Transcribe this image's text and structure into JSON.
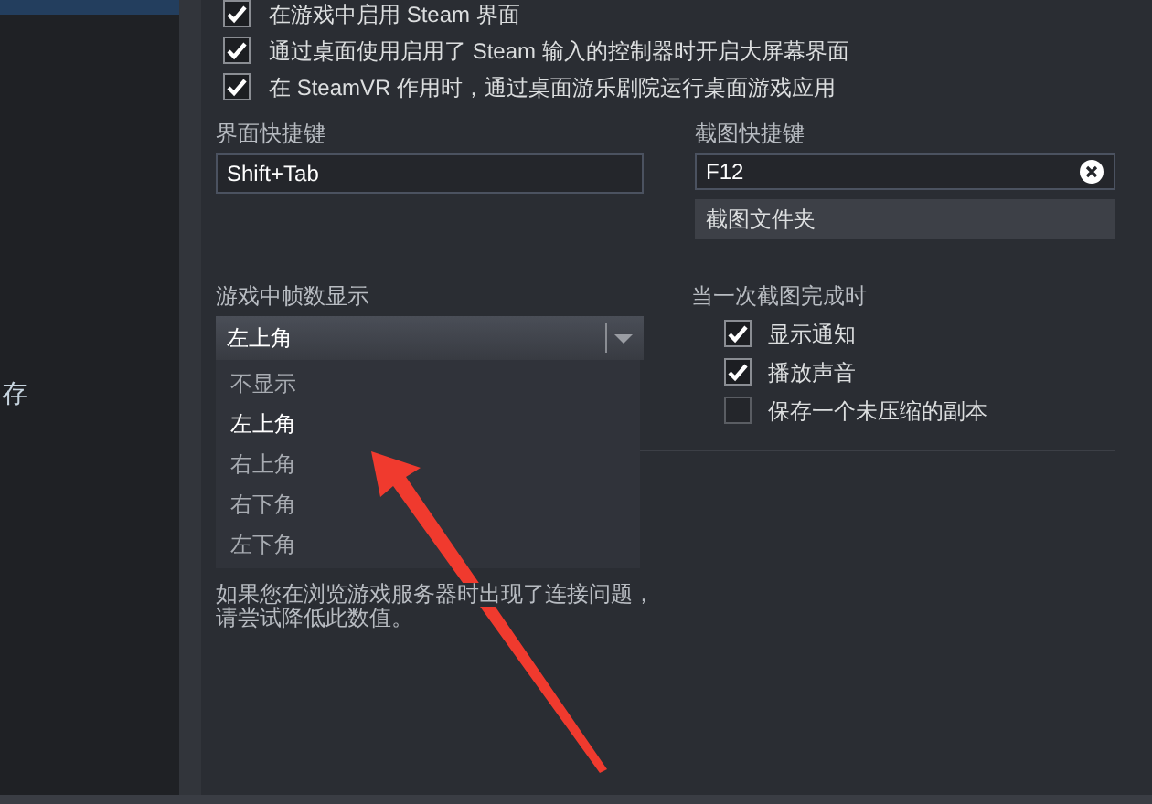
{
  "sidebar": {
    "items": [
      {
        "selected": true
      },
      {
        "label": "存",
        "selected": false
      }
    ]
  },
  "overlay_options": [
    {
      "label": "在游戏中启用 Steam 界面",
      "checked": true
    },
    {
      "label": "通过桌面使用启用了 Steam 输入的控制器时开启大屏幕界面",
      "checked": true
    },
    {
      "label": "在 SteamVR 作用时，通过桌面游乐剧院运行桌面游戏应用",
      "checked": true
    }
  ],
  "overlay_shortcut": {
    "label": "界面快捷键",
    "value": "Shift+Tab"
  },
  "screenshot_shortcut": {
    "label": "截图快捷键",
    "value": "F12",
    "folder_button": "截图文件夹"
  },
  "fps_counter": {
    "label": "游戏中帧数显示",
    "value": "左上角",
    "expanded": true,
    "options": [
      {
        "label": "不显示",
        "selected": false
      },
      {
        "label": "左上角",
        "selected": true
      },
      {
        "label": "右上角",
        "selected": false
      },
      {
        "label": "右下角",
        "selected": false
      },
      {
        "label": "左下角",
        "selected": false
      }
    ],
    "note": [
      "如果您在浏览游戏服务器时出现了连接问题，",
      "请尝试降低此数值。"
    ]
  },
  "screenshot_done": {
    "label": "当一次截图完成时",
    "options": [
      {
        "label": "显示通知",
        "checked": true
      },
      {
        "label": "播放声音",
        "checked": true
      },
      {
        "label": "保存一个未压缩的副本",
        "checked": false
      }
    ]
  }
}
